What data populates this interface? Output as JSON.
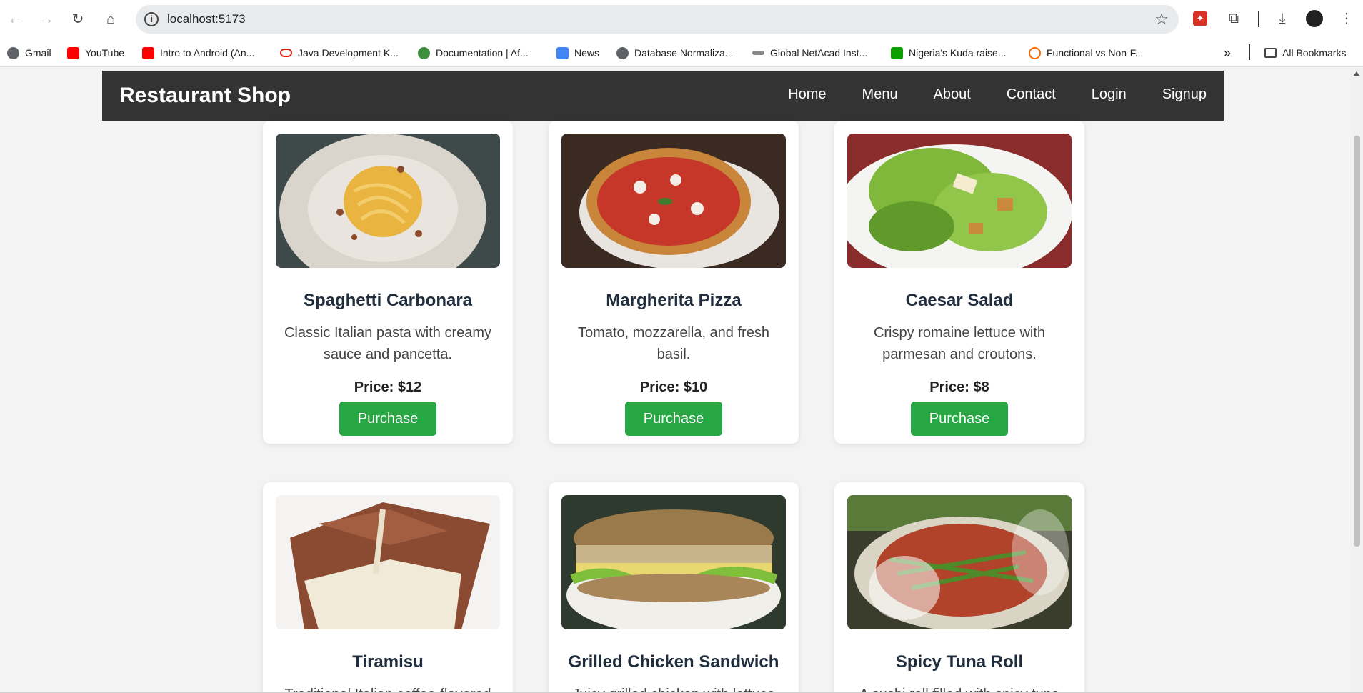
{
  "browser": {
    "url": "localhost:5173",
    "bookmarks": [
      {
        "label": "Gmail",
        "icon": "globe-icon",
        "color": "#5f6368"
      },
      {
        "label": "YouTube",
        "icon": "youtube-icon",
        "color": "#ff0000"
      },
      {
        "label": "Intro to Android (An...",
        "icon": "youtube-icon",
        "color": "#ff0000"
      },
      {
        "label": "Java Development K...",
        "icon": "oracle-icon",
        "color": "#e2231a"
      },
      {
        "label": "Documentation | Af...",
        "icon": "docs-icon",
        "color": "#3f8f3f"
      },
      {
        "label": "News",
        "icon": "news-icon",
        "color": "#4285f4"
      },
      {
        "label": "Database Normaliza...",
        "icon": "globe-icon",
        "color": "#5f6368"
      },
      {
        "label": "Global NetAcad Inst...",
        "icon": "cisco-icon",
        "color": "#555555"
      },
      {
        "label": "Nigeria's Kuda raise...",
        "icon": "techcrunch-icon",
        "color": "#0a9e01"
      },
      {
        "label": "Functional vs Non-F...",
        "icon": "search-icon",
        "color": "#ff6a00"
      }
    ],
    "all_bookmarks": "All Bookmarks",
    "more": "»"
  },
  "site": {
    "brand": "Restaurant Shop",
    "nav": [
      "Home",
      "Menu",
      "About",
      "Contact",
      "Login",
      "Signup"
    ]
  },
  "menu": [
    {
      "title": "Spaghetti Carbonara",
      "desc": "Classic Italian pasta with creamy sauce and pancetta.",
      "price": "Price: $12",
      "button": "Purchase"
    },
    {
      "title": "Margherita Pizza",
      "desc": "Tomato, mozzarella, and fresh basil.",
      "price": "Price: $10",
      "button": "Purchase"
    },
    {
      "title": "Caesar Salad",
      "desc": "Crispy romaine lettuce with parmesan and croutons.",
      "price": "Price: $8",
      "button": "Purchase"
    },
    {
      "title": "Tiramisu",
      "desc": "Traditional Italian coffee-flavored",
      "price": "",
      "button": ""
    },
    {
      "title": "Grilled Chicken Sandwich",
      "desc": "Juicy grilled chicken with lettuce",
      "price": "",
      "button": ""
    },
    {
      "title": "Spicy Tuna Roll",
      "desc": "A sushi roll filled with spicy tuna",
      "price": "",
      "button": ""
    }
  ],
  "colors": {
    "nav_bg": "#333333",
    "button": "#28a745",
    "page_bg": "#f3f3f3"
  }
}
